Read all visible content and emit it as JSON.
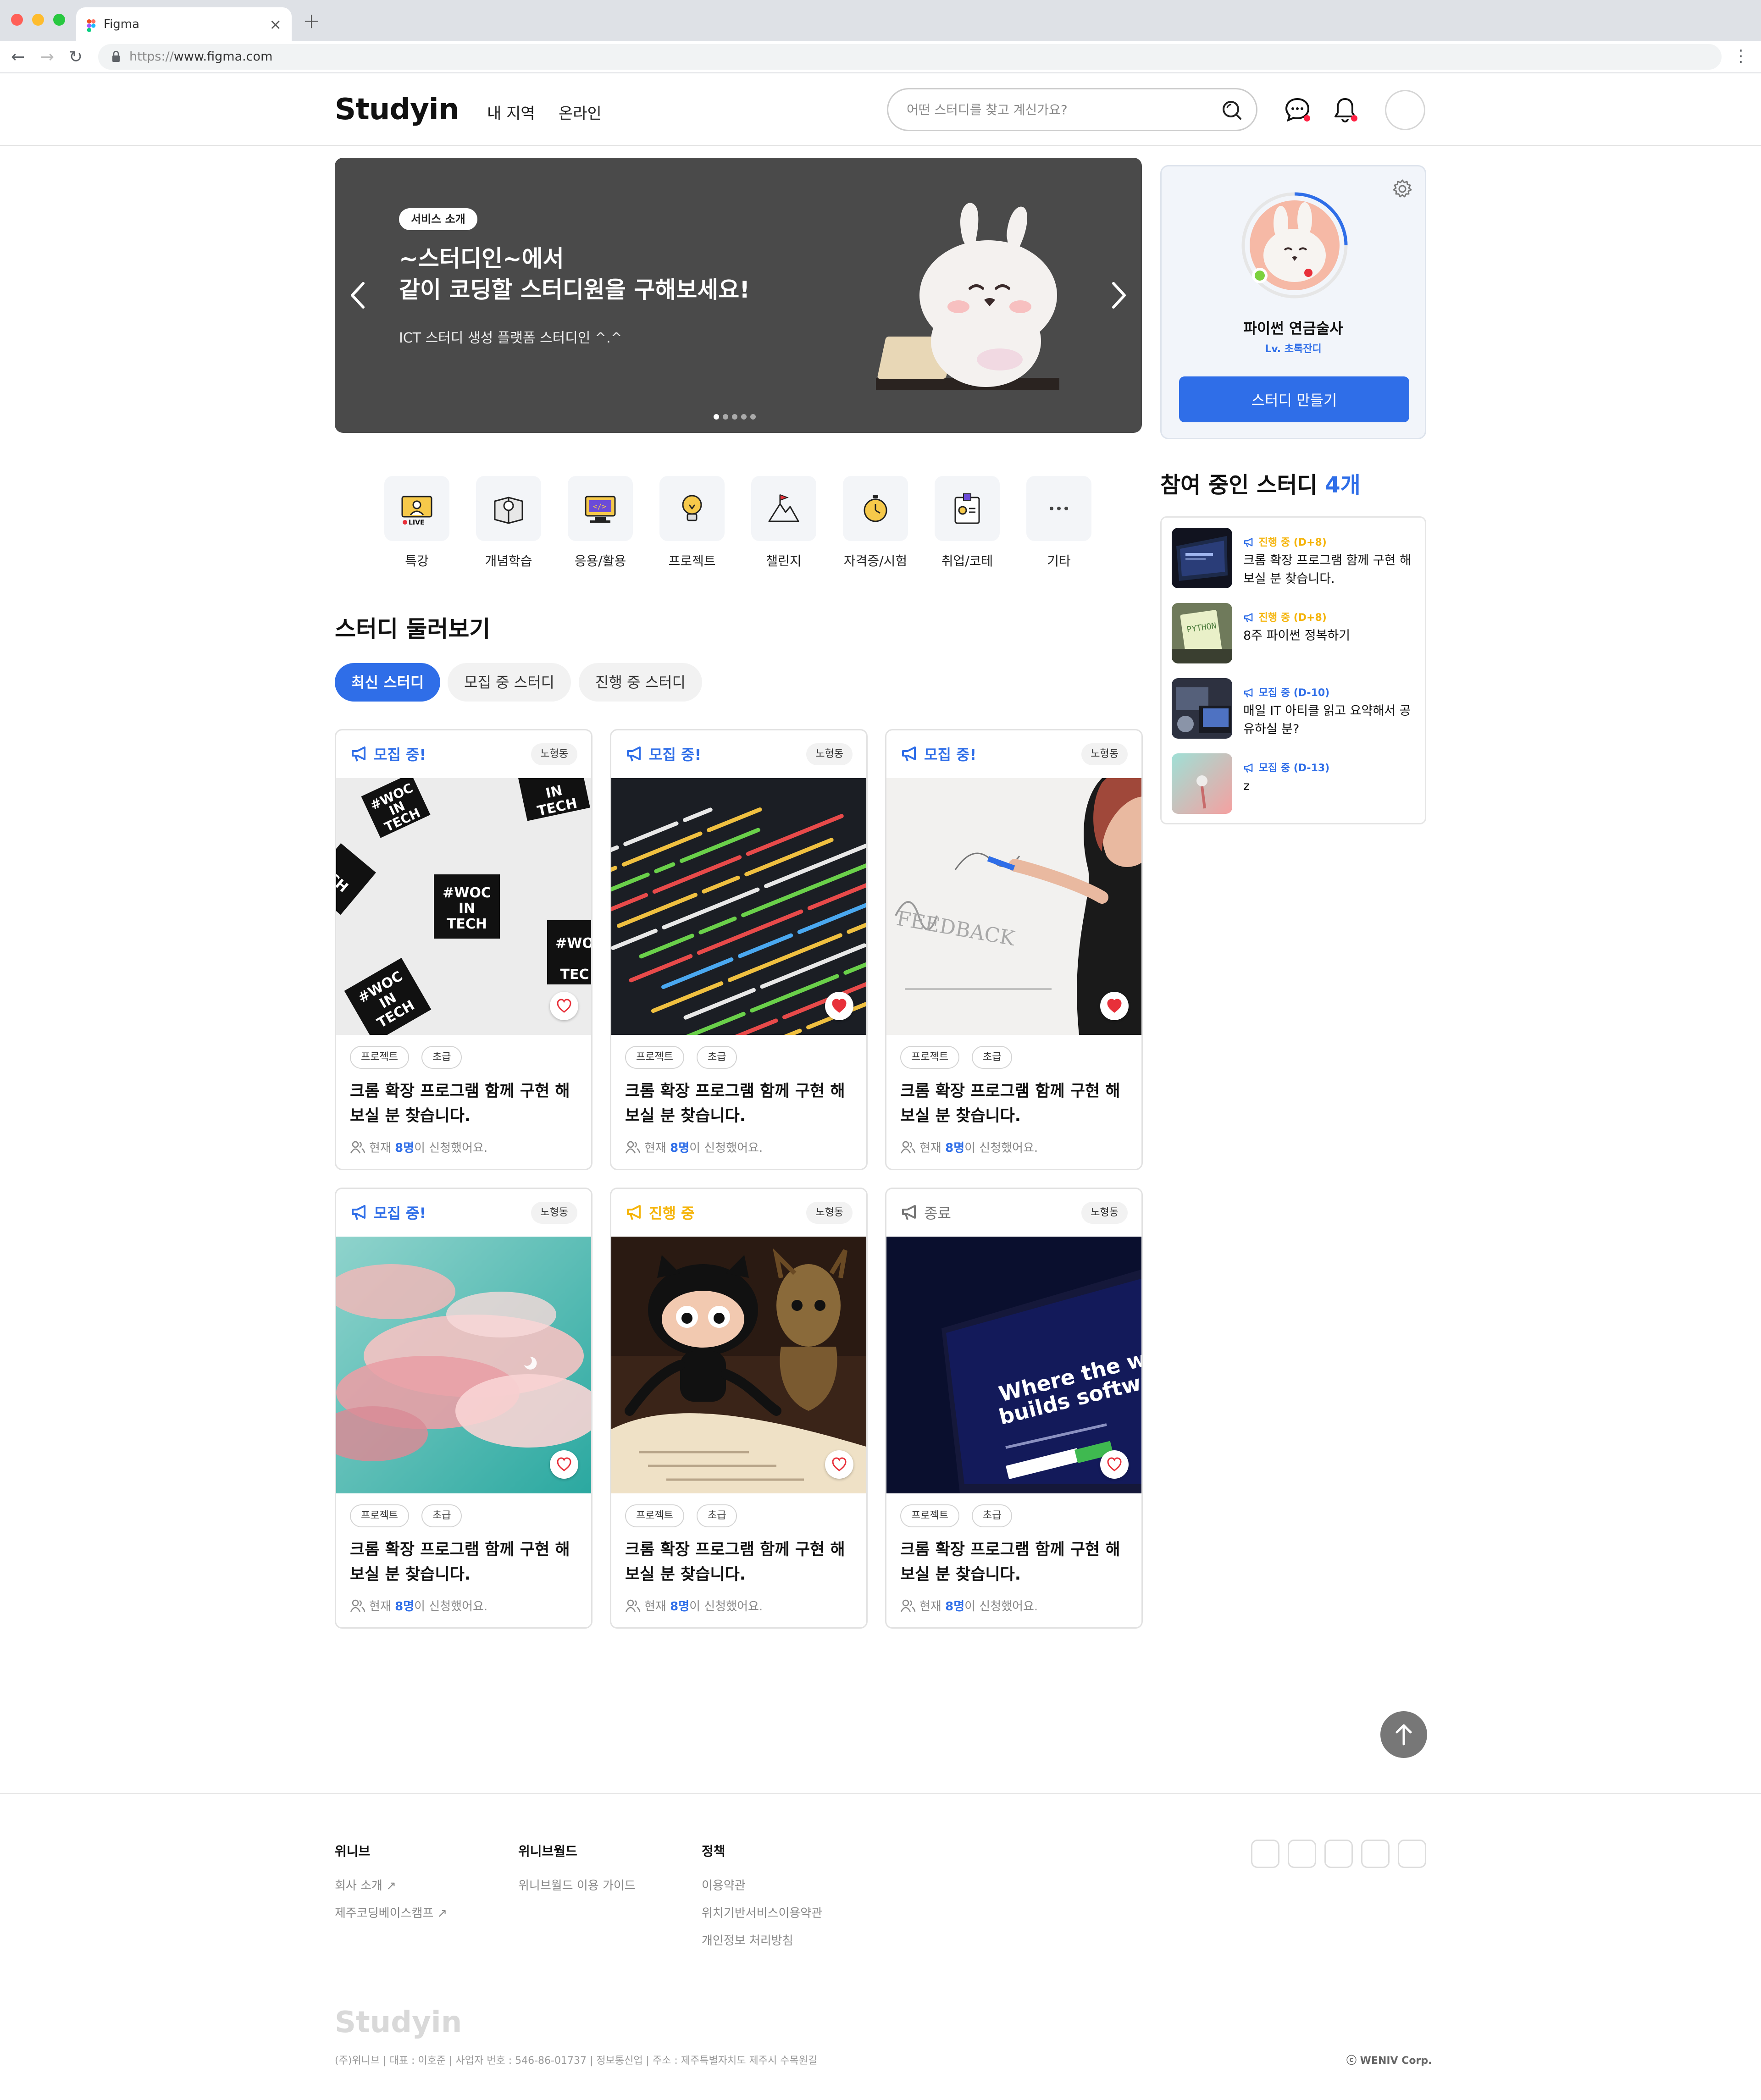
{
  "browser": {
    "tab_title": "Figma",
    "url_scheme": "https://",
    "url_host": "www.figma.com"
  },
  "header": {
    "logo": "Studyin",
    "nav": [
      "내 지역",
      "온라인"
    ],
    "search_placeholder": "어떤 스터디를 찾고 계신가요?"
  },
  "hero": {
    "badge": "서비스 소개",
    "title": "~스터디인~에서\n같이 코딩할 스터디원을 구해보세요!",
    "subtitle": "ICT 스터디 생성 플랫폼 스터디인 ^.^",
    "slide_count": 5,
    "active_slide": 1
  },
  "profile": {
    "name": "파이썬 연금술사",
    "level": "Lv. 초록잔디",
    "create_button": "스터디 만들기"
  },
  "joined": {
    "title": "참여 중인 스터디",
    "count": "4개",
    "items": [
      {
        "status": "진행 중 (D+8)",
        "title": "크롬 확장 프로그램 함께 구현 해 보실 분 찾습니다."
      },
      {
        "status": "진행 중 (D+8)",
        "title": "8주 파이썬 정복하기"
      },
      {
        "status": "모집 중 (D-10)",
        "title": "매일 IT 아티클 읽고 요약해서 공유하실 분?"
      },
      {
        "status": "모집 중 (D-13)",
        "title": "z"
      }
    ]
  },
  "categories": [
    "특강",
    "개념학습",
    "응용/활용",
    "프로젝트",
    "챌린지",
    "자격증/시험",
    "취업/코테",
    "기타"
  ],
  "browse": {
    "title": "스터디 둘러보기",
    "filters": [
      "최신 스터디",
      "모집 중 스터디",
      "진행 중 스터디"
    ]
  },
  "cards": [
    {
      "status": "모집 중!",
      "location": "노형동",
      "tags": [
        "프로젝트",
        "초급"
      ],
      "title": "크롬 확장 프로그램 함께 구현 해 보실 분 찾습니다.",
      "meta_pre": "현재 ",
      "meta_num": "8명",
      "meta_post": "이 신청했어요.",
      "liked": false
    },
    {
      "status": "모집 중!",
      "location": "노형동",
      "tags": [
        "프로젝트",
        "초급"
      ],
      "title": "크롬 확장 프로그램 함께 구현 해 보실 분 찾습니다.",
      "meta_pre": "현재 ",
      "meta_num": "8명",
      "meta_post": "이 신청했어요.",
      "liked": true
    },
    {
      "status": "모집 중!",
      "location": "노형동",
      "tags": [
        "프로젝트",
        "초급"
      ],
      "title": "크롬 확장 프로그램 함께 구현 해 보실 분 찾습니다.",
      "meta_pre": "현재 ",
      "meta_num": "8명",
      "meta_post": "이 신청했어요.",
      "liked": true
    },
    {
      "status": "모집 중!",
      "location": "노형동",
      "tags": [
        "프로젝트",
        "초급"
      ],
      "title": "크롬 확장 프로그램 함께 구현 해 보실 분 찾습니다.",
      "meta_pre": "현재 ",
      "meta_num": "8명",
      "meta_post": "이 신청했어요.",
      "liked": false
    },
    {
      "status": "진행 중",
      "location": "노형동",
      "tags": [
        "프로젝트",
        "초급"
      ],
      "title": "크롬 확장 프로그램 함께 구현 해 보실 분 찾습니다.",
      "meta_pre": "현재 ",
      "meta_num": "8명",
      "meta_post": "이 신청했어요.",
      "liked": false
    },
    {
      "status": "종료",
      "location": "노형동",
      "tags": [
        "프로젝트",
        "초급"
      ],
      "title": "크롬 확장 프로그램 함께 구현 해 보실 분 찾습니다.",
      "meta_pre": "현재 ",
      "meta_num": "8명",
      "meta_post": "이 신청했어요.",
      "liked": false
    }
  ],
  "footer": {
    "columns": [
      {
        "head": "위니브",
        "links": [
          "회사 소개 ↗",
          "제주코딩베이스캠프 ↗"
        ]
      },
      {
        "head": "위니브월드",
        "links": [
          "위니브월드 이용 가이드"
        ]
      },
      {
        "head": "정책",
        "links": [
          "이용약관",
          "위치기반서비스이용약관",
          "개인정보 처리방침"
        ]
      }
    ],
    "logo": "Studyin",
    "info": "(주)위니브 | 대표 : 이호준 | 사업자 번호 : 546-86-01737 | 정보통신업 | 주소 : 제주특별자치도 제주시 수목원길",
    "copyright": "ⓒ WENIV Corp."
  },
  "colors": {
    "accent": "#2f6ee8",
    "progress": "#f5b40a",
    "ended": "#777777",
    "heart": "#e8303a"
  }
}
